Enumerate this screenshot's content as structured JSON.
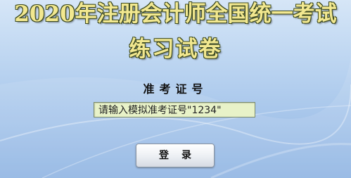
{
  "title": {
    "line1": "2020年注册会计师全国统一考试",
    "line2": "练习试卷"
  },
  "login_form": {
    "label": "准考证号",
    "input_value": "请输入模拟准考证号\"1234\"",
    "button_label": "登录"
  },
  "colors": {
    "title_fill": "#f2e890",
    "input_bg": "#e8f2c8",
    "background_top": "#d6e6f7",
    "background_bottom": "#8fb4e3"
  }
}
